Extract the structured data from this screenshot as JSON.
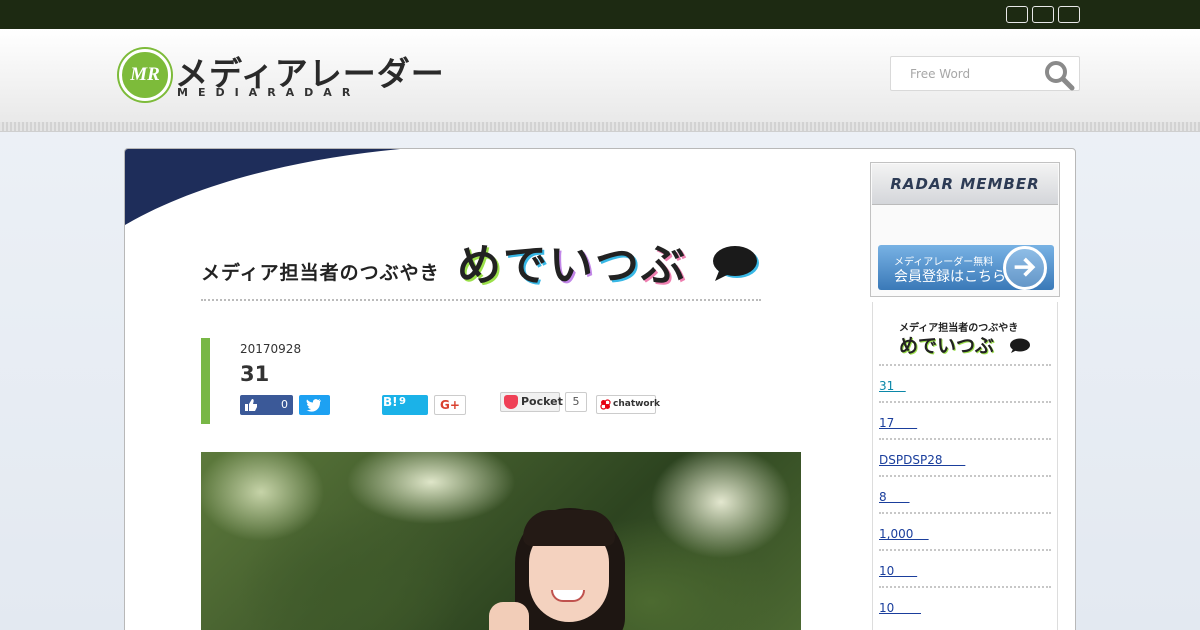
{
  "header": {
    "logo_text": "メディアレーダー",
    "logo_subtext": "MEDIARADAR",
    "logo_mark": "MR",
    "search_placeholder": "Free Word"
  },
  "banner": {
    "small_text": "メディア担当者のつぶやき",
    "big_text": [
      "め",
      "で",
      "い",
      "つ",
      "ぶ"
    ]
  },
  "post": {
    "date": "20170928",
    "title": "31",
    "share": {
      "facebook_count": "0",
      "hatena_label": "B!",
      "hatena_count": "9",
      "googleplus_label": "G+",
      "pocket_label": "Pocket",
      "pocket_count": "5",
      "chatwork_label": "chatwork"
    }
  },
  "sidebar": {
    "member_title": "RADAR MEMBER",
    "member_button_line1": "メディアレーダー無料",
    "member_button_line2": "会員登録はこちら",
    "list_banner_small": "メディア担当者のつぶやき",
    "list_banner_big": "めでいつぶ",
    "items": [
      "31   ",
      "17      ",
      "DSPDSP28      ",
      "8      ",
      "1,000    ",
      "10      ",
      "10       "
    ]
  },
  "colors": {
    "topbar": "#1d2a12",
    "accent_green": "#78b746",
    "navy": "#1e2d5a",
    "member_blue": "#3a79b8"
  }
}
